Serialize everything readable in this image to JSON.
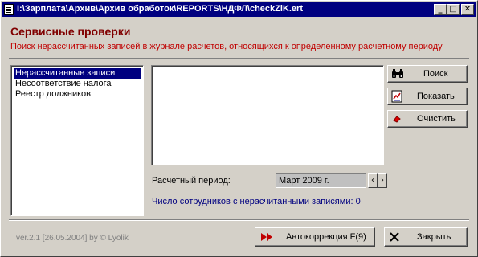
{
  "window": {
    "title": "I:\\Зарплата\\Архив\\Архив обработок\\REPORTS\\НДФЛ\\checkZiK.ert",
    "minimize_glyph": "_",
    "maximize_glyph": "□",
    "close_glyph": "✕"
  },
  "header": {
    "title": "Сервисные проверки",
    "description": "Поиск нерассчитанных записей в журнале расчетов, относящихся к определенному расчетному периоду"
  },
  "checks_list": {
    "items": [
      {
        "label": "Нерассчитанные записи",
        "selected": true
      },
      {
        "label": "Несоответствие налога",
        "selected": false
      },
      {
        "label": "Реестр должников",
        "selected": false
      }
    ]
  },
  "buttons": {
    "search": "Поиск",
    "show": "Показать",
    "clear": "Очистить",
    "autocorrect": "Автокоррекция F(9)",
    "close": "Закрыть"
  },
  "period": {
    "label": "Расчетный период:",
    "value": "Март 2009 г.",
    "prev_glyph": "‹",
    "next_glyph": "›"
  },
  "status": {
    "count_text": "Число сотрудников с нерасчитанными записями: 0"
  },
  "footer": {
    "version": "ver.2.1 [26.05.2004] by © Lyolik"
  },
  "colors": {
    "title_bar": "#000080",
    "heading": "#800000",
    "description": "#c00000",
    "selection": "#000080",
    "count_text": "#000080"
  },
  "icons": [
    "document-icon",
    "binoculars-icon",
    "show-report-icon",
    "eraser-icon",
    "fast-forward-icon",
    "close-x-icon"
  ]
}
